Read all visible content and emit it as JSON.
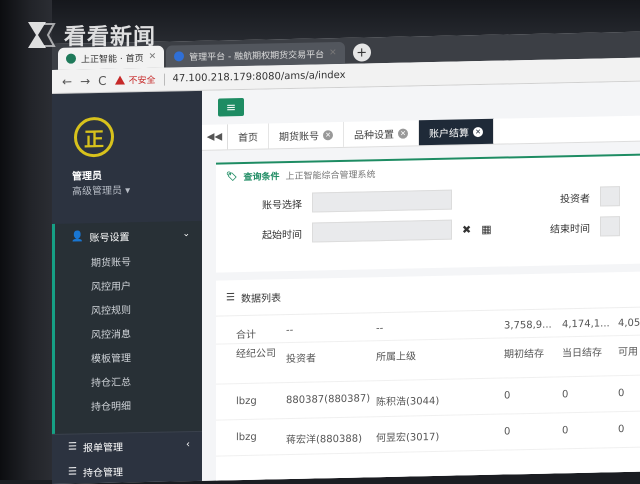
{
  "watermark": {
    "text": "看看新闻"
  },
  "browser": {
    "tabs": [
      {
        "title": "上正智能 · 首页",
        "active": true
      },
      {
        "title": "管理平台 - 融航期权期货交易平台",
        "active": false
      }
    ],
    "new_tab": "+",
    "back": "←",
    "forward": "→",
    "reload": "C",
    "security_label": "不安全",
    "url": "47.100.218.179:8080/ams/a/index"
  },
  "sidebar": {
    "user_name": "管理员",
    "user_role": "高级管理员 ▾",
    "logo_glyph": "正",
    "group": {
      "label": "账号设置",
      "chevron": "⌄"
    },
    "items": [
      "期货账号",
      "风控用户",
      "风控规则",
      "风控消息",
      "模板管理",
      "持仓汇总",
      "持仓明细"
    ],
    "group2": {
      "label": "报单管理",
      "chevron": "‹"
    },
    "group3": {
      "label": "持仓管理"
    }
  },
  "content": {
    "menu_button": "≡",
    "tabs_prev": "◀◀",
    "page_tabs": [
      {
        "label": "首页",
        "closable": false,
        "active": false
      },
      {
        "label": "期货账号",
        "closable": true,
        "active": false
      },
      {
        "label": "品种设置",
        "closable": true,
        "active": false
      },
      {
        "label": "账户结算",
        "closable": true,
        "active": true
      }
    ],
    "query": {
      "title": "查询条件",
      "subtitle": "上正智能综合管理系统",
      "account_label": "账号选择",
      "investor_label": "投资者",
      "start_label": "起始时间",
      "end_label": "结束时间",
      "clear_icon": "✖",
      "calendar_icon": "▦"
    },
    "list": {
      "title": "数据列表",
      "summary": [
        "合计",
        "--",
        "--",
        "3,758,9...",
        "4,174,1...",
        "4,05"
      ],
      "headers": [
        "经纪公司",
        "投资者",
        "所属上级",
        "期初结存",
        "当日结存",
        "可用"
      ],
      "rows": [
        [
          "lbzg",
          "880387(880387)",
          "陈积浩(3044)",
          "0",
          "0",
          "0"
        ],
        [
          "lbzg",
          "蒋宏洋(880388)",
          "何昱宏(3017)",
          "0",
          "0",
          "0"
        ]
      ]
    }
  },
  "colors": {
    "accent": "#1e8c63",
    "sidebar": "#2c3340",
    "logo": "#d8c21c",
    "active_tab": "#1f2a38",
    "warning": "#c62828"
  }
}
